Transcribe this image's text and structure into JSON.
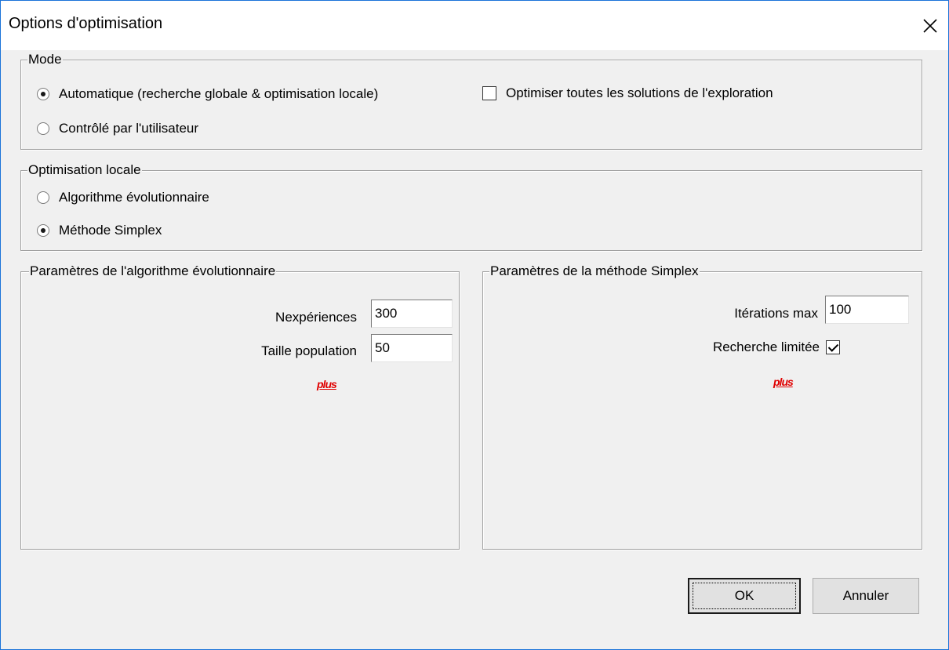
{
  "window": {
    "title": "Options d'optimisation",
    "close_glyph": "✕"
  },
  "mode": {
    "legend": "Mode",
    "options": [
      {
        "label": "Automatique (recherche globale & optimisation locale)",
        "selected": true
      },
      {
        "label": "Contrôlé par l'utilisateur",
        "selected": false
      }
    ],
    "optimize_all": {
      "label": "Optimiser toutes les solutions de l'exploration",
      "checked": false
    }
  },
  "local_optimization": {
    "legend": "Optimisation locale",
    "options": [
      {
        "label": "Algorithme évolutionnaire",
        "selected": false
      },
      {
        "label": "Méthode Simplex",
        "selected": true
      }
    ]
  },
  "evolutionary_params": {
    "legend": "Paramètres de l'algorithme évolutionnaire",
    "nexperiences_label": "Nexpériences",
    "nexperiences_value": "300",
    "population_label": "Taille population",
    "population_value": "50",
    "more_link": "plus"
  },
  "simplex_params": {
    "legend": "Paramètres de la méthode Simplex",
    "iterations_label": "Itérations max",
    "iterations_value": "100",
    "limited_search_label": "Recherche limitée",
    "limited_search_checked": true,
    "more_link": "plus"
  },
  "buttons": {
    "ok": "OK",
    "cancel": "Annuler"
  },
  "colors": {
    "window_border": "#1a73d9",
    "background": "#f0f0f0",
    "link": "#e00000"
  }
}
